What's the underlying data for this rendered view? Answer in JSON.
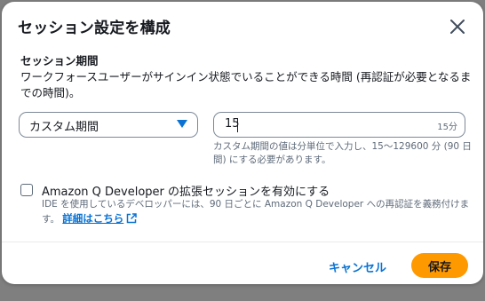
{
  "dialog": {
    "title": "セッション設定を構成",
    "close_icon": "close-icon"
  },
  "session": {
    "label": "セッション期間",
    "description": "ワークフォースユーザーがサインイン状態でいることができる時間 (再認証が必要となるまでの時間)。",
    "select_value": "カスタム期間",
    "input_value": "15",
    "input_suffix": "15分",
    "hint": "カスタム期間の値は分単位で入力し、15〜129600 分 (90 日間) にする必要があります。"
  },
  "q_developer": {
    "checked": false,
    "label": "Amazon Q Developer の拡張セッションを有効にする",
    "description": "IDE を使用しているデベロッパーには、90 日ごとに Amazon Q Developer への再認証を義務付けます。",
    "link_text": "詳細はこちら",
    "link_icon": "external-link-icon"
  },
  "footer": {
    "cancel_label": "キャンセル",
    "save_label": "保存"
  },
  "colors": {
    "accent": "#0972d3",
    "primary_button": "#ff9900",
    "overlay": "#7f7f7f"
  }
}
